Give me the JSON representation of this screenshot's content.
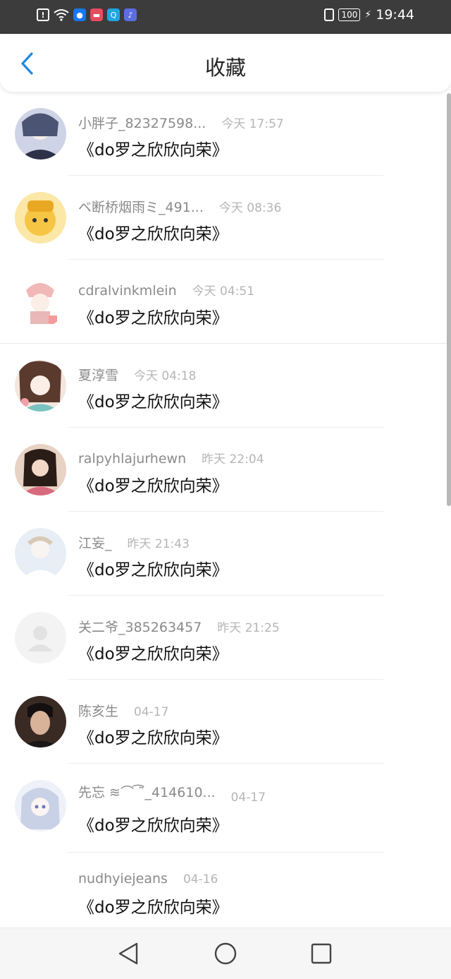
{
  "status_bar": {
    "time": "19:44",
    "battery": "100",
    "left_icons": [
      "alert-icon",
      "wifi-icon",
      "app-icon-blue",
      "app-icon-red",
      "app-icon-search",
      "app-icon-music"
    ]
  },
  "header": {
    "title": "收藏",
    "back_icon": "chevron-left-icon",
    "accent": "#1e88e5"
  },
  "favorites": [
    {
      "name": "小胖子_82327598...",
      "time": "今天 17:57",
      "topic": "《do罗之欣欣向荣》"
    },
    {
      "name": "ベ断桥烟雨ミ_491...",
      "time": "今天 08:36",
      "topic": "《do罗之欣欣向荣》"
    },
    {
      "name": "cdralvinkmlein",
      "time": "今天 04:51",
      "topic": "《do罗之欣欣向荣》"
    },
    {
      "name": "夏淳雪",
      "time": "今天 04:18",
      "topic": "《do罗之欣欣向荣》"
    },
    {
      "name": "ralpyhlajurhewn",
      "time": "昨天 22:04",
      "topic": "《do罗之欣欣向荣》"
    },
    {
      "name": "江妄_",
      "time": "昨天 21:43",
      "topic": "《do罗之欣欣向荣》"
    },
    {
      "name": "关二爷_385263457",
      "time": "昨天 21:25",
      "topic": "《do罗之欣欣向荣》"
    },
    {
      "name": "陈亥生",
      "time": "04-17",
      "topic": "《do罗之欣欣向荣》"
    },
    {
      "name": "先忘 ≋⌒ ͡˜_414610...",
      "time": "04-17",
      "topic": "《do罗之欣欣向荣》"
    },
    {
      "name": "nudhyiejeans",
      "time": "04-16",
      "topic": "《do罗之欣欣向荣》"
    }
  ],
  "nav": {
    "back_icon": "triangle-back-icon",
    "home_icon": "circle-home-icon",
    "recent_icon": "square-recent-icon"
  }
}
